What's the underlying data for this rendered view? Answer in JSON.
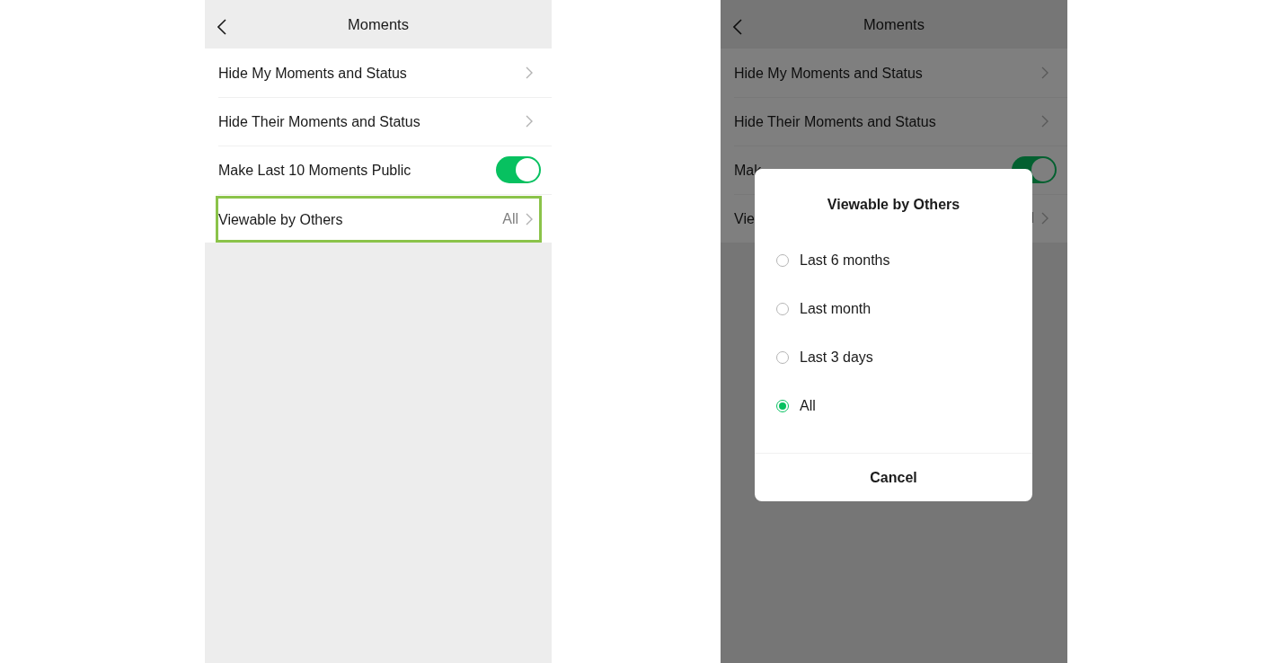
{
  "screens": [
    {
      "title": "Moments",
      "rows": [
        {
          "kind": "link",
          "label": "Hide My Moments and Status",
          "highlighted": false
        },
        {
          "kind": "link",
          "label": "Hide Their Moments and Status",
          "highlighted": false
        },
        {
          "kind": "toggle",
          "label": "Make Last 10 Moments Public",
          "on": true,
          "highlighted": false
        },
        {
          "kind": "link",
          "label": "Viewable by Others",
          "value": "All",
          "highlighted": true
        }
      ]
    },
    {
      "title": "Moments",
      "dimmed": true,
      "rows": [
        {
          "kind": "link",
          "label": "Hide My Moments and Status",
          "highlighted": false
        },
        {
          "kind": "link",
          "label": "Hide Their Moments and Status",
          "highlighted": false
        },
        {
          "kind": "toggle",
          "label": "Mak",
          "on": true,
          "highlighted": false
        },
        {
          "kind": "link",
          "label": "Vie",
          "value": "l",
          "highlighted": false
        }
      ],
      "dialog": {
        "title": "Viewable by Others",
        "options": [
          {
            "label": "Last 6 months",
            "selected": false
          },
          {
            "label": "Last month",
            "selected": false
          },
          {
            "label": "Last 3 days",
            "selected": false
          },
          {
            "label": "All",
            "selected": true
          }
        ],
        "cancel": "Cancel"
      }
    }
  ]
}
